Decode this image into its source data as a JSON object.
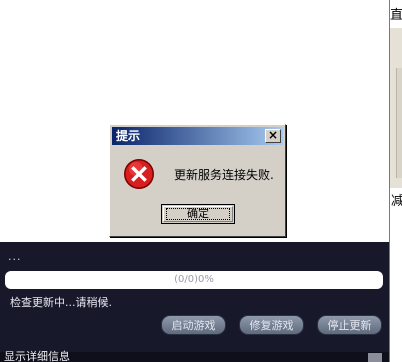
{
  "launcher": {
    "dots": "...",
    "progress_text": "(0/0)0%",
    "status": "检查更新中...请稍候.",
    "buttons": {
      "start_game": "启动游戏",
      "repair_game": "修复游戏",
      "stop_update": "停止更新"
    },
    "details_label": "显示详细信息"
  },
  "dialog": {
    "title": "提示",
    "close_label": "×",
    "message": "更新服务连接失败.",
    "ok_label": "确定"
  },
  "background_window": {
    "title_fragment": "直的",
    "side_char": "减"
  },
  "colors": {
    "titlebar_start": "#0a246a",
    "titlebar_end": "#a6caf0",
    "dialog_face": "#d4d0c8",
    "launcher_panel": "#17182a",
    "error_red": "#d81e1e"
  },
  "icons": [
    "error-icon",
    "close-icon"
  ]
}
